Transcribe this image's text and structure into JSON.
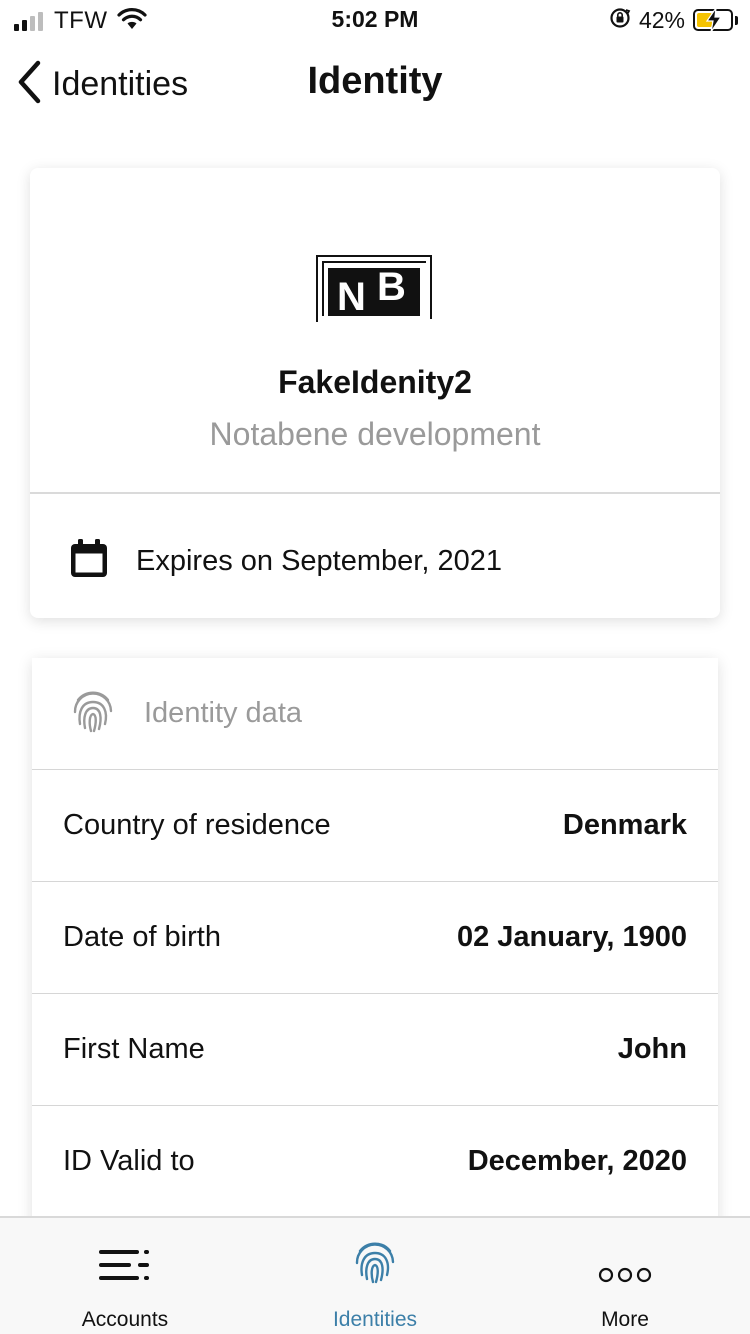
{
  "status_bar": {
    "carrier": "TFW",
    "time": "5:02 PM",
    "battery_percent": "42%",
    "battery_level": 0.42,
    "icons": [
      "signal-icon",
      "wifi-icon",
      "rotation-lock-icon",
      "battery-charging-icon"
    ]
  },
  "nav": {
    "back_label": "Identities",
    "title": "Identity"
  },
  "identity": {
    "logo_text": "NB",
    "name": "FakeIdenity2",
    "issuer": "Notabene development",
    "expiry": "Expires on September, 2021"
  },
  "identity_data": {
    "header": "Identity data",
    "rows": [
      {
        "label": "Country of residence",
        "value": "Denmark"
      },
      {
        "label": "Date of birth",
        "value": "02 January, 1900"
      },
      {
        "label": "First Name",
        "value": "John"
      },
      {
        "label": "ID Valid to",
        "value": "December, 2020"
      }
    ]
  },
  "tabs": [
    {
      "label": "Accounts",
      "icon": "accounts-list-icon",
      "active": false
    },
    {
      "label": "Identities",
      "icon": "fingerprint-icon",
      "active": true
    },
    {
      "label": "More",
      "icon": "more-dots-icon",
      "active": false
    }
  ],
  "colors": {
    "accent": "#3c7fa8",
    "muted_text": "#9a9a9a",
    "battery_fill": "#f5c300"
  }
}
